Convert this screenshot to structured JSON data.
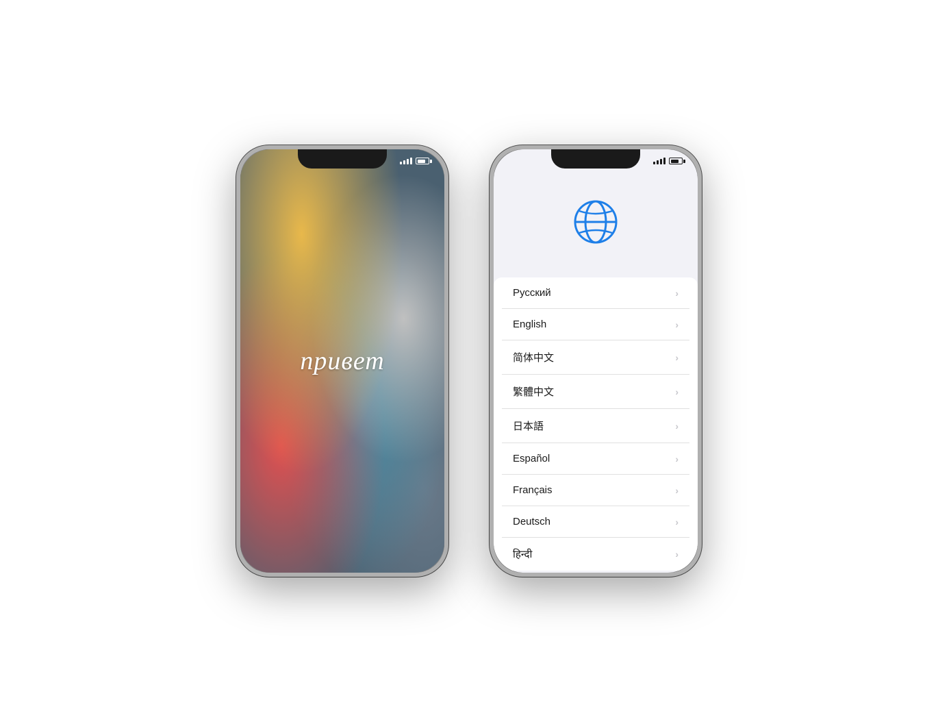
{
  "left_phone": {
    "greeting": "привет",
    "status": {
      "signal_label": "signal",
      "battery_label": "battery"
    }
  },
  "right_phone": {
    "status": {
      "signal_label": "signal",
      "battery_label": "battery"
    },
    "globe_icon": "globe-icon",
    "languages": [
      {
        "label": "Русский",
        "id": "russian"
      },
      {
        "label": "English",
        "id": "english"
      },
      {
        "label": "简体中文",
        "id": "simplified-chinese"
      },
      {
        "label": "繁體中文",
        "id": "traditional-chinese"
      },
      {
        "label": "日本語",
        "id": "japanese"
      },
      {
        "label": "Español",
        "id": "spanish"
      },
      {
        "label": "Français",
        "id": "french"
      },
      {
        "label": "Deutsch",
        "id": "german"
      },
      {
        "label": "हिन्दी",
        "id": "hindi"
      }
    ],
    "chevron": "›"
  }
}
